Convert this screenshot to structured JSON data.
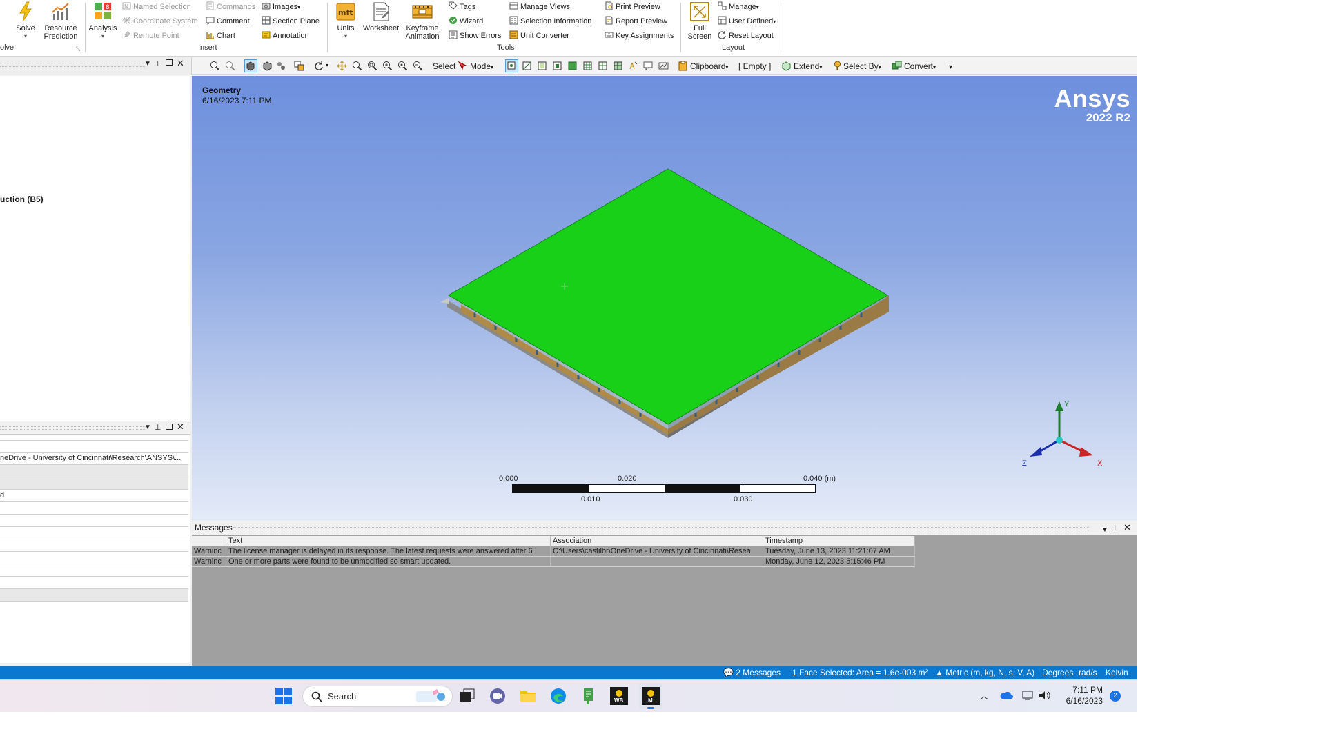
{
  "ribbon": {
    "solve_group": {
      "solve": "Solve",
      "resource_prediction": "Resource\nPrediction",
      "group_label": "olve"
    },
    "analysis": "Analysis",
    "insert_group": {
      "named_selection": "Named Selection",
      "coordinate_system": "Coordinate System",
      "remote_point": "Remote Point",
      "commands": "Commands",
      "comment": "Comment",
      "chart": "Chart",
      "images": "Images",
      "section_plane": "Section Plane",
      "annotation": "Annotation",
      "group_label": "Insert"
    },
    "tools_group": {
      "units": "Units",
      "worksheet": "Worksheet",
      "keyframe_animation": "Keyframe\nAnimation",
      "tags": "Tags",
      "wizard": "Wizard",
      "show_errors": "Show Errors",
      "manage_views": "Manage Views",
      "selection_information": "Selection Information",
      "unit_converter": "Unit Converter",
      "print_preview": "Print Preview",
      "report_preview": "Report Preview",
      "key_assignments": "Key Assignments",
      "group_label": "Tools"
    },
    "layout_group": {
      "full_screen": "Full\nScreen",
      "manage": "Manage",
      "user_defined": "User Defined",
      "reset_layout": "Reset Layout",
      "group_label": "Layout"
    }
  },
  "toolbar": {
    "select": "Select",
    "mode": "Mode",
    "clipboard": "Clipboard",
    "empty": "[ Empty ]",
    "extend": "Extend",
    "select_by": "Select By",
    "convert": "Convert"
  },
  "tree": {
    "visible_item": "uction (B5)"
  },
  "details": {
    "path_row": "neDrive - University of Cincinnati\\Research\\ANSYS\\...",
    "row_d": "d"
  },
  "viewport": {
    "title": "Geometry",
    "date": "6/16/2023 7:11 PM",
    "logo_name": "Ansys",
    "logo_version": "2022 R2",
    "scale_labels_top": [
      "0.000",
      "0.020",
      "0.040 (m)"
    ],
    "scale_labels_bottom": [
      "0.010",
      "0.030"
    ],
    "axes": {
      "y": "Y",
      "x": "X",
      "z": "Z"
    }
  },
  "messages": {
    "title": "Messages",
    "columns": [
      "",
      "Text",
      "Association",
      "Timestamp"
    ],
    "rows": [
      [
        "Warninc",
        "The license manager is delayed in its response. The latest requests were answered after 6",
        "C:\\Users\\castilbr\\OneDrive - University of Cincinnati\\Resea",
        "Tuesday, June 13, 2023 11:21:07 AM"
      ],
      [
        "Warninc",
        "One or more parts were found to be unmodified so smart updated.",
        "",
        "Monday, June 12, 2023 5:15:46 PM"
      ]
    ]
  },
  "status": {
    "messages": "2 Messages",
    "selection": "1 Face Selected: Area = 1.6e-003 m²",
    "units": "Metric (m, kg, N, s, V, A)",
    "degrees": "Degrees",
    "rads": "rad/s",
    "temp": "Kelvin"
  },
  "taskbar": {
    "search": "Search",
    "time": "7:11 PM",
    "date": "6/16/2023",
    "notifications": "2",
    "wb_label": "WB",
    "m_label": "M"
  },
  "colors": {
    "accent": "#0a78cf",
    "geometry_face": "#19d019",
    "viewport_top": "#6d8fdd",
    "viewport_bottom": "#e4ebf8"
  }
}
